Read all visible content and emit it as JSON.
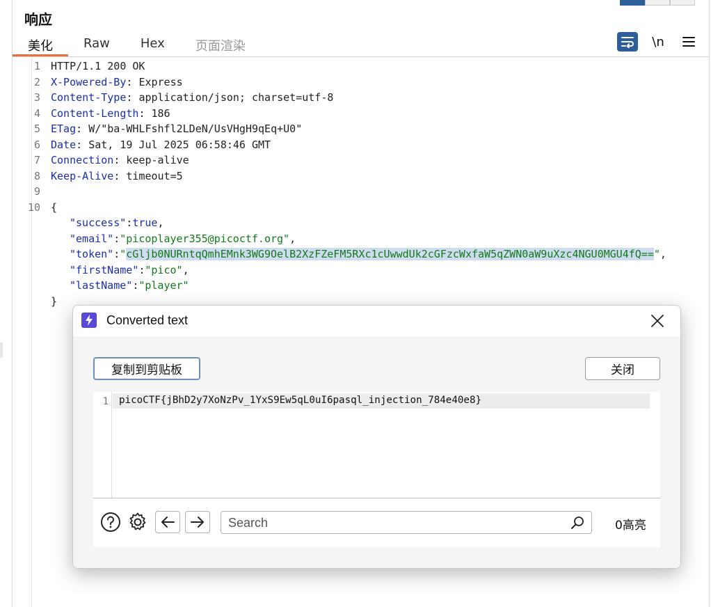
{
  "panel": {
    "title": "响应"
  },
  "tabs": [
    {
      "label": "美化",
      "active": true
    },
    {
      "label": "Raw"
    },
    {
      "label": "Hex"
    },
    {
      "label": "页面渲染",
      "disabled": true
    }
  ],
  "toolbar": {
    "newline_label": "\\n"
  },
  "response": {
    "line_numbers": [
      "1",
      "2",
      "3",
      "4",
      "5",
      "6",
      "7",
      "8",
      "9",
      "10"
    ],
    "status_line": "HTTP/1.1 200 OK",
    "headers": [
      {
        "key": "X-Powered-By",
        "value": "Express"
      },
      {
        "key": "Content-Type",
        "value": "application/json; charset=utf-8"
      },
      {
        "key": "Content-Length",
        "value": "186"
      },
      {
        "key": "ETag",
        "value": "W/\"ba-WHLFshfl2LDeN/UsVHgH9qEq+U0\""
      },
      {
        "key": "Date",
        "value": "Sat, 19 Jul 2025 06:58:46 GMT"
      },
      {
        "key": "Connection",
        "value": "keep-alive"
      },
      {
        "key": "Keep-Alive",
        "value": "timeout=5"
      }
    ],
    "body_open": "{",
    "body_close": "}",
    "body": {
      "success_key": "\"success\"",
      "success_val": "true",
      "email_key": "\"email\"",
      "email_val": "\"picoplayer355@picoctf.org\"",
      "token_key": "\"token\"",
      "token_val": "cGljb0NURntqQmhEMnk3WG9OelB2XzFZeFM5RXc1cUwwdUk2cGFzcWxfaW5qZWN0aW9uXzc4NGU0MGU4fQ==",
      "firstName_key": "\"firstName\"",
      "firstName_val": "\"pico\"",
      "lastName_key": "\"lastName\"",
      "lastName_val": "\"player\""
    }
  },
  "dialog": {
    "title": "Converted text",
    "copy_label": "复制到剪贴板",
    "close_label": "关闭",
    "output_line_number": "1",
    "output_text": "picoCTF{jBhD2y7XoNzPv_1YxS9Ew5qL0uI6pasql_injection_784e40e8}",
    "search_placeholder": "Search",
    "highlight_count": "0高亮"
  },
  "colors": {
    "accent_tab": "#e8703a",
    "header_key": "#1a2ea8",
    "json_string": "#127a1a",
    "selection": "#cfdcef",
    "dialog_icon": "#5a48d8",
    "toggle_active": "#2f5f9a"
  }
}
